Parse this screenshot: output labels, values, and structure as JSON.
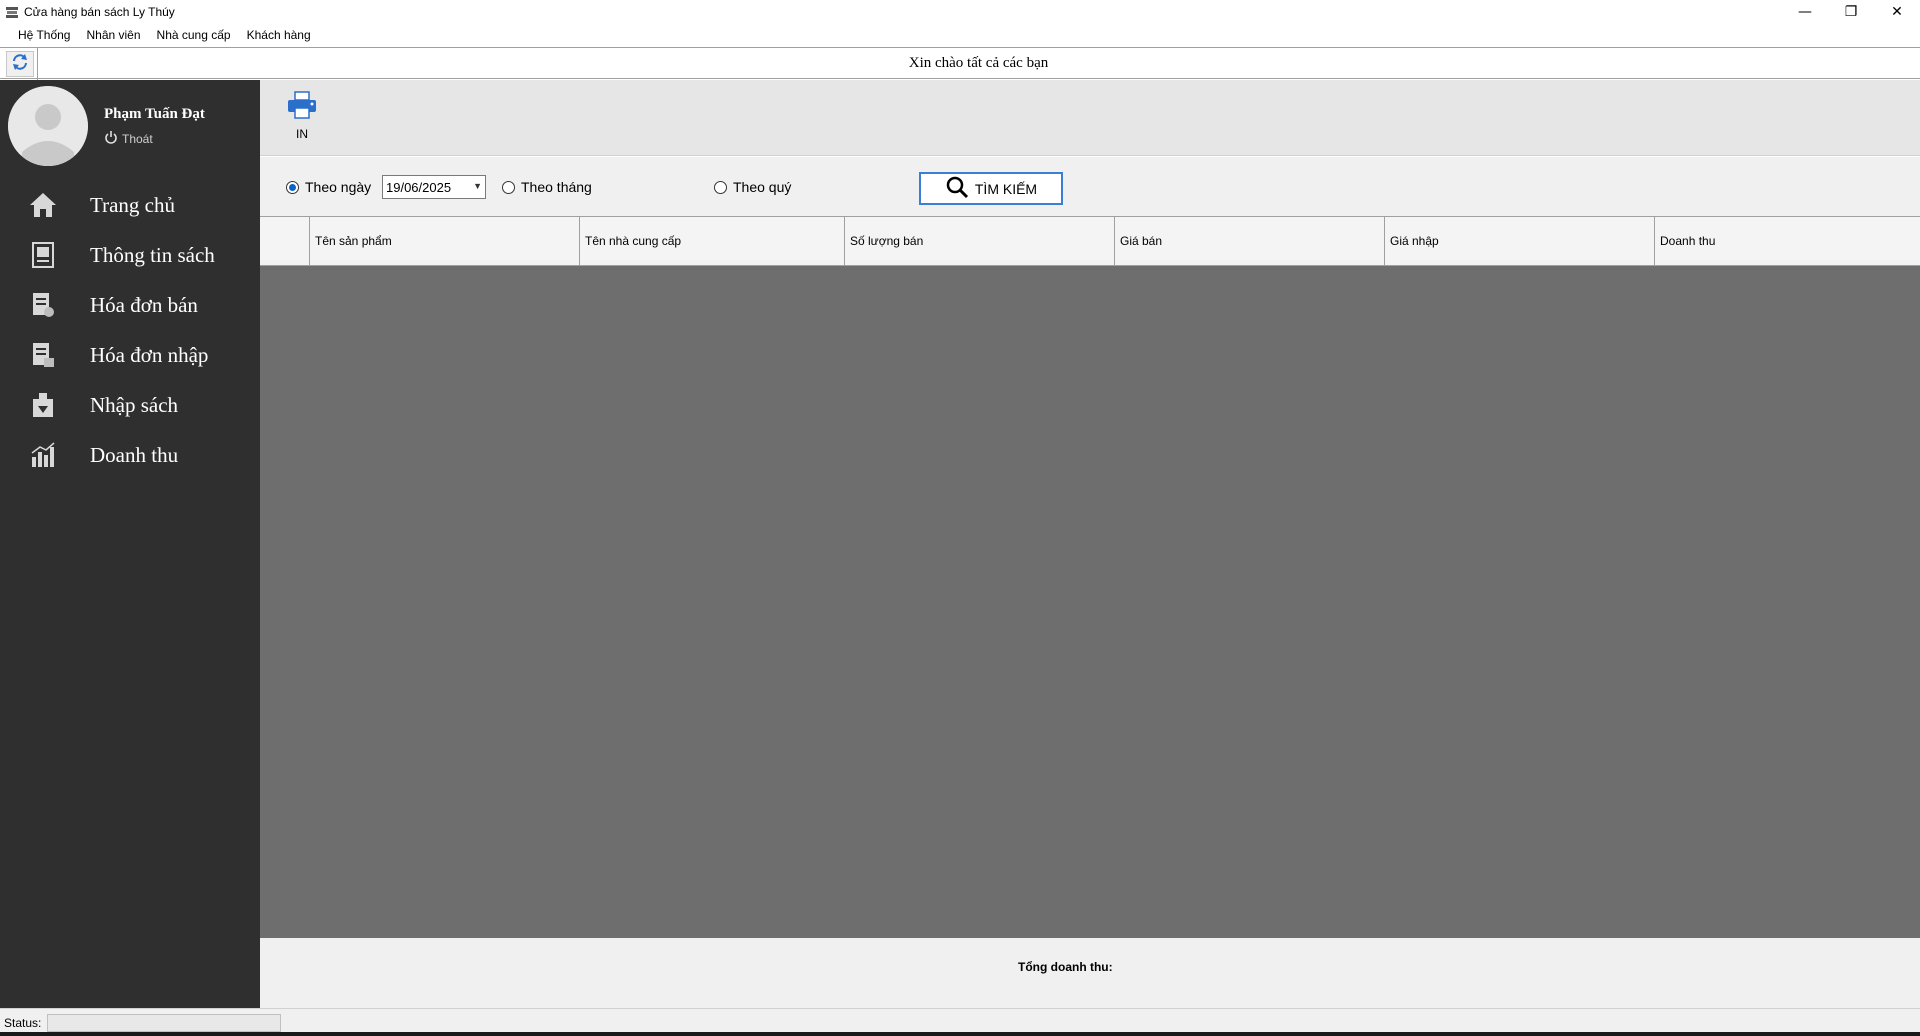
{
  "window": {
    "title": "Cửa hàng bán sách Ly Thúy",
    "minimize": "—",
    "maximize": "❐",
    "close": "✕"
  },
  "menu": [
    "Hệ Thống",
    "Nhân viên",
    "Nhà cung cấp",
    "Khách hàng"
  ],
  "header": {
    "greeting": "Xin chào tất cả các bạn"
  },
  "user": {
    "name": "Phạm Tuấn Đạt",
    "logout": "Thoát"
  },
  "nav": [
    {
      "label": "Trang chủ",
      "icon": "home-icon"
    },
    {
      "label": "Thông tin sách",
      "icon": "book-info-icon"
    },
    {
      "label": "Hóa đơn bán",
      "icon": "sales-invoice-icon"
    },
    {
      "label": "Hóa đơn nhập",
      "icon": "purchase-invoice-icon"
    },
    {
      "label": "Nhập sách",
      "icon": "import-book-icon"
    },
    {
      "label": "Doanh thu",
      "icon": "revenue-chart-icon"
    }
  ],
  "toolbar": {
    "print_label": "IN"
  },
  "filters": {
    "by_day": "Theo ngày",
    "date_value": "19/06/2025",
    "by_month": "Theo tháng",
    "by_quarter": "Theo quý",
    "search_label": "TÌM KIẾM",
    "selected": "by_day"
  },
  "table": {
    "columns": [
      "Tên  sản phẩm",
      "Tên nhà cung cấp",
      "Số lượng bán",
      "Giá bán",
      "Giá nhập",
      "Doanh thu"
    ],
    "rows": []
  },
  "footer": {
    "total_label": "Tổng doanh thu:"
  },
  "status": {
    "label": "Status:"
  },
  "colors": {
    "sidebar": "#2f2f2f",
    "grid_background": "#6e6e6e",
    "accent": "#0a64c8"
  }
}
